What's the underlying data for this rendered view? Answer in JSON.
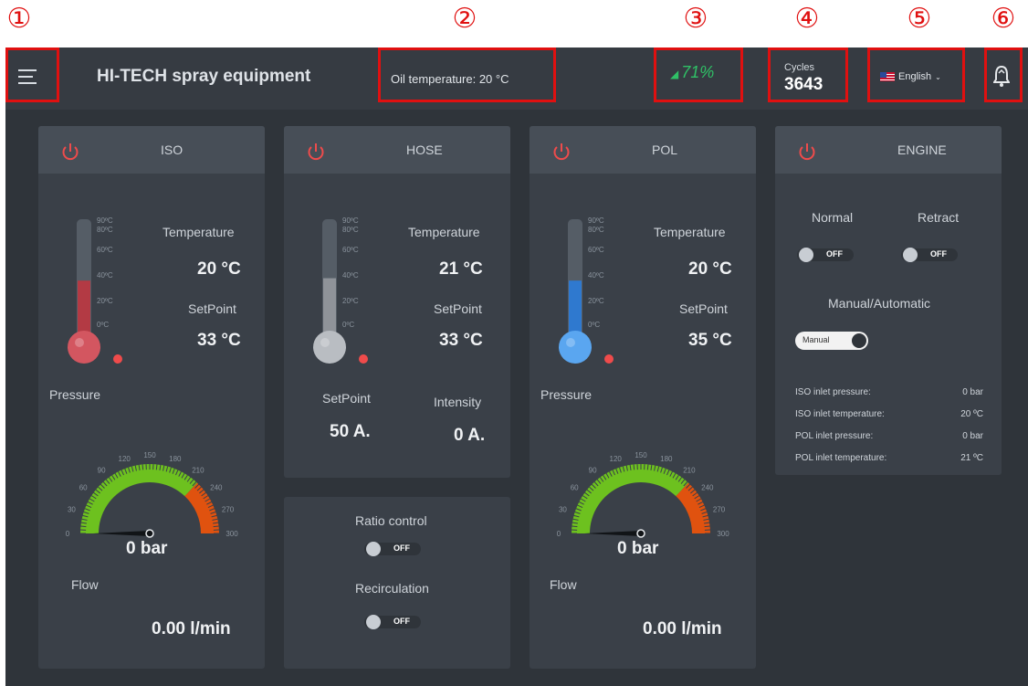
{
  "markers": [
    "①",
    "②",
    "③",
    "④",
    "⑤",
    "⑥"
  ],
  "header": {
    "title": "HI-TECH spray equipment",
    "oil_temperature": "Oil temperature: 20 °C",
    "signal": "71%",
    "cycles_label": "Cycles",
    "cycles_value": "3643",
    "language": "English",
    "icons": [
      "menu-icon",
      "wifi-signal-icon",
      "us-flag-icon",
      "chevron-down-icon",
      "bell-icon"
    ]
  },
  "colors": {
    "accent_red": "#e01010",
    "power_red": "#ef4b4b",
    "signal_green": "#2fc166",
    "gauge_green": "#6dc11f",
    "gauge_orange": "#e0520f",
    "thermo_blue": "#3d8ee0"
  },
  "iso": {
    "title": "ISO",
    "temperature_label": "Temperature",
    "temperature_value": "20 °C",
    "setpoint_label": "SetPoint",
    "setpoint_value": "33 °C",
    "thermo_level": 0.2,
    "pressure_label": "Pressure",
    "gauge_value": "0 bar",
    "flow_label": "Flow",
    "flow_value": "0.00  l/min"
  },
  "hose": {
    "title": "HOSE",
    "temperature_label": "Temperature",
    "temperature_value": "21 °C",
    "setpoint_label": "SetPoint",
    "setpoint_value": "33 °C",
    "thermo_level": 0.21,
    "current_setpoint_label": "SetPoint",
    "current_setpoint_value": "50 A.",
    "intensity_label": "Intensity",
    "intensity_value": "0 A."
  },
  "ratio": {
    "ratio_label": "Ratio control",
    "ratio_state": "OFF",
    "recirc_label": "Recirculation",
    "recirc_state": "OFF"
  },
  "pol": {
    "title": "POL",
    "temperature_label": "Temperature",
    "temperature_value": "20 °C",
    "setpoint_label": "SetPoint",
    "setpoint_value": "35 °C",
    "thermo_level": 0.2,
    "pressure_label": "Pressure",
    "gauge_value": "0 bar",
    "flow_label": "Flow",
    "flow_value": "0.00  l/min"
  },
  "thermo_scale": [
    "90ºC",
    "80ºC",
    "60ºC",
    "40ºC",
    "20ºC",
    "0ºC"
  ],
  "gauge_scale": [
    "0",
    "30",
    "60",
    "90",
    "120",
    "150",
    "180",
    "210",
    "240",
    "270",
    "300"
  ],
  "engine": {
    "title": "ENGINE",
    "normal_label": "Normal",
    "normal_state": "OFF",
    "retract_label": "Retract",
    "retract_state": "OFF",
    "mode_label": "Manual/Automatic",
    "mode_state": "Manual",
    "info": [
      {
        "label": "ISO inlet pressure:",
        "value": "0 bar"
      },
      {
        "label": "ISO inlet temperature:",
        "value": "20 ºC"
      },
      {
        "label": "POL inlet pressure:",
        "value": "0 bar"
      },
      {
        "label": "POL inlet temperature:",
        "value": "21 ºC"
      }
    ]
  }
}
